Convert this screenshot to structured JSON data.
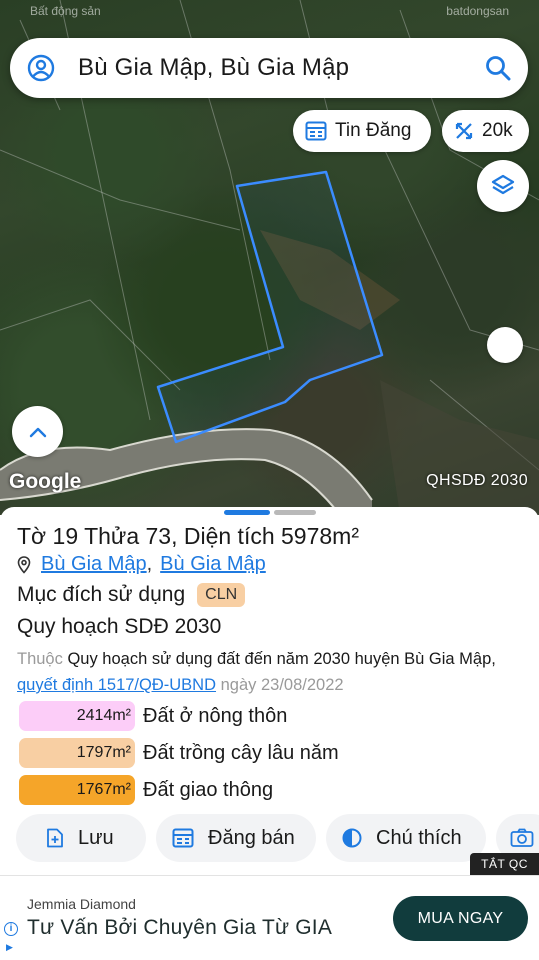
{
  "status_bar": {
    "left": "Bất động sản",
    "right": "batdongsan"
  },
  "search": {
    "query": "Bù Gia Mập, Bù Gia Mập"
  },
  "map": {
    "tin_dang_label": "Tin Đăng",
    "zoom_label": "20k",
    "google_logo": "Google",
    "source_label": "QHSDĐ 2030",
    "parcel_outline_color": "#3b8cff"
  },
  "parcel": {
    "title": "Tờ 19 Thửa 73, Diện tích 5978m²",
    "location_commune": "Bù Gia Mập",
    "location_separator": ",",
    "location_district": "Bù Gia Mập",
    "purpose_label": "Mục đích sử dụng",
    "purpose_code": "CLN",
    "plan_title": "Quy hoạch SDĐ 2030",
    "plan_prefix": "Thuộc",
    "plan_text": " Quy hoạch sử dụng đất đến năm 2030 huyện Bù Gia Mập, ",
    "plan_decision": "quyết định 1517/QĐ-UBND",
    "plan_date": " ngày 23/08/2022"
  },
  "land_use": [
    {
      "area": "2414m²",
      "label": "Đất ở nông thôn",
      "color": "#fccdf8"
    },
    {
      "area": "1797m²",
      "label": "Đất trồng cây lâu năm",
      "color": "#f8cfa3"
    },
    {
      "area": "1767m²",
      "label": "Đất giao thông",
      "color": "#f5a529"
    }
  ],
  "actions": {
    "save_label": "Lưu",
    "post_label": "Đăng bán",
    "legend_label": "Chú thích"
  },
  "ads": {
    "close_label": "TẮT QC",
    "brand": "Jemmia Diamond",
    "headline": "Tư Vấn Bởi Chuyên Gia Từ GIA",
    "cta": "MUA NGAY"
  }
}
